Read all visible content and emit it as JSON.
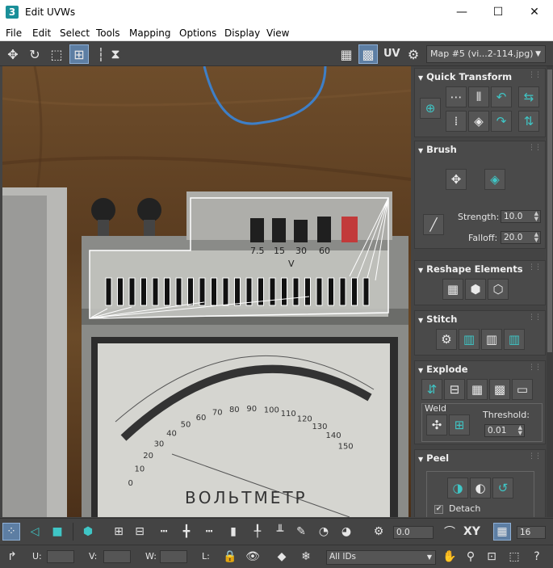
{
  "window": {
    "app_icon": "3",
    "title": "Edit UVWs",
    "minimize": "—",
    "maximize": "☐",
    "close": "✕"
  },
  "menu": [
    "File",
    "Edit",
    "Select",
    "Tools",
    "Mapping",
    "Options",
    "Display",
    "View"
  ],
  "toolbar": {
    "uv_label": "UV",
    "map_dropdown": "Map #5 (vi...2-114.jpg)",
    "icons": [
      "move-icon",
      "rotate-icon",
      "scale-icon",
      "freeform-icon",
      "mirror-icon",
      "checker-icon",
      "texture-icon",
      "uv-icon",
      "settings-icon"
    ]
  },
  "viewport": {
    "switch_labels": [
      "7.5",
      "15",
      "30",
      "60"
    ],
    "meter_scale": [
      "0",
      "10",
      "20",
      "30",
      "40",
      "50",
      "60",
      "70",
      "80",
      "90",
      "100",
      "110",
      "120",
      "130",
      "140",
      "150"
    ],
    "meter_unit": "V",
    "meter_name": "ВОЛЬТМЕТР"
  },
  "panel": {
    "quick_transform": {
      "title": "Quick Transform"
    },
    "brush": {
      "title": "Brush",
      "strength_label": "Strength:",
      "strength_value": "10.0",
      "falloff_label": "Falloff:",
      "falloff_value": "20.0"
    },
    "reshape": {
      "title": "Reshape Elements"
    },
    "stitch": {
      "title": "Stitch"
    },
    "explode": {
      "title": "Explode",
      "weld_label": "Weld",
      "threshold_label": "Threshold:",
      "threshold_value": "0.01"
    },
    "peel": {
      "title": "Peel",
      "detach_label": "Detach",
      "detach_checked": "✔"
    }
  },
  "bottom": {
    "rotation_value": "0.0",
    "xy_label": "XY",
    "grid_value": "16",
    "u_label": "U:",
    "v_label": "V:",
    "w_label": "W:",
    "l_label": "L:",
    "ids_dropdown": "All IDs"
  },
  "colors": {
    "accent": "#3fc6c6",
    "panel_bg": "#444444",
    "active": "#5d7ea3"
  }
}
